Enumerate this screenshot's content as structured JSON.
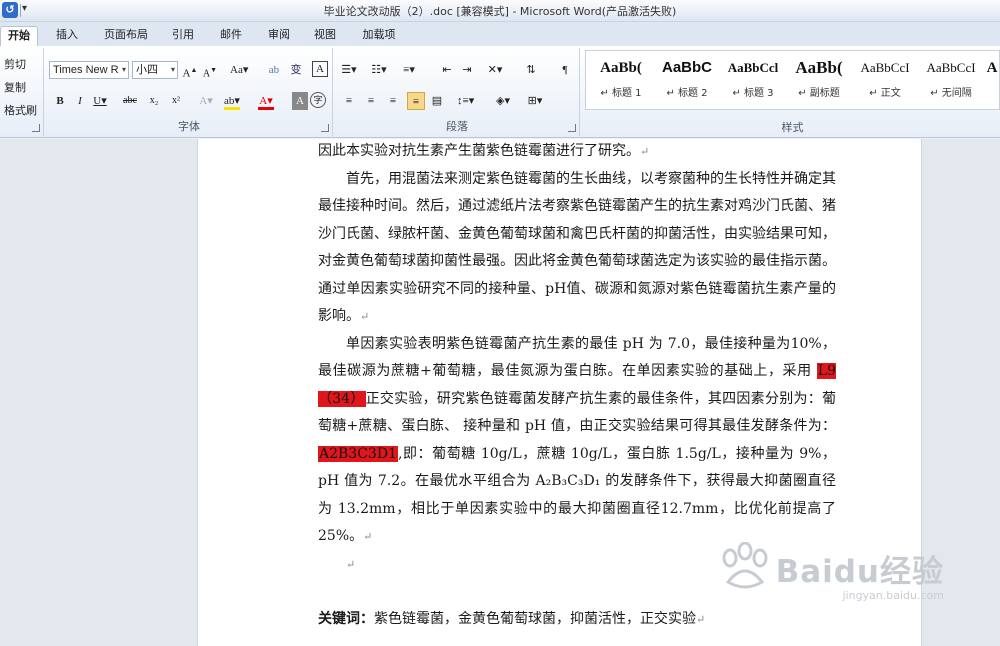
{
  "window": {
    "title": "毕业论文改动版（2）.doc [兼容模式] - Microsoft Word(产品激活失败)"
  },
  "tabs": [
    "开始",
    "插入",
    "页面布局",
    "引用",
    "邮件",
    "审阅",
    "视图",
    "加载项"
  ],
  "clipboard": {
    "cut": "剪切",
    "copy": "复制",
    "format_painter": "格式刷"
  },
  "font": {
    "name": "Times New R",
    "size": "小四",
    "label": "字体"
  },
  "paragraph": {
    "label": "段落"
  },
  "styles": {
    "label": "样式",
    "items": [
      {
        "preview": "AaBb(",
        "name": "标题 1"
      },
      {
        "preview": "AaBbC",
        "name": "标题 2"
      },
      {
        "preview": "AaBbCcl",
        "name": "标题 3"
      },
      {
        "preview": "AaBb(",
        "name": "副标题"
      },
      {
        "preview": "AaBbCcI",
        "name": "正文"
      },
      {
        "preview": "AaBbCcI",
        "name": "无间隔"
      }
    ]
  },
  "document": {
    "line0": "因此本实验对抗生素产生菌紫色链霉菌进行了研究。",
    "p1": "首先，用混菌法来测定紫色链霉菌的生长曲线，以考察菌种的生长特性并确定其最佳接种时间。然后，通过滤纸片法考察紫色链霉菌产生的抗生素对鸡沙门氏菌、猪沙门氏菌、绿脓杆菌、金黄色葡萄球菌和禽巴氏杆菌的抑菌活性，由实验结果可知，对金黄色葡萄球菌抑菌性最强。因此将金黄色葡萄球菌选定为该实验的最佳指示菌。通过单因素实验研究不同的接种量、pH值、碳源和氮源对紫色链霉菌抗生素产量的影响。",
    "p2_a": "单因素实验表明紫色链霉菌产抗生素的最佳 pH 为 7.0，最佳接种量为10%，最佳碳源为蔗糖+葡萄糖，最佳氮源为蛋白胨。在单因素实验的基础上，采用 ",
    "p2_hl1": "L9（34）",
    "p2_b": "正交实验，研究紫色链霉菌发酵产抗生素的最佳条件，其四因素分别为：葡萄糖+蔗糖、蛋白胨、 接种量和 pH 值，由正交实验结果可得其最佳发酵条件为：",
    "p2_hl2": "A2B3C3D1",
    "p2_c": ",即：葡萄糖 10g/L，蔗糖 10g/L，蛋白胨 1.5g/L，接种量为 9%，pH 值为 7.2。在最优水平组合为 A₂B₃C₃D₁ 的发酵条件下，获得最大抑菌圈直径为 13.2mm，相比于单因素实验中的最大抑菌圈直径12.7mm，比优化前提高了 25%。",
    "keywords_label": "关键词：",
    "keywords": "紫色链霉菌，金黄色葡萄球菌，抑菌活性，正交实验"
  },
  "watermark": {
    "brand": "Baidu经验",
    "url": "jingyan.baidu.com"
  }
}
